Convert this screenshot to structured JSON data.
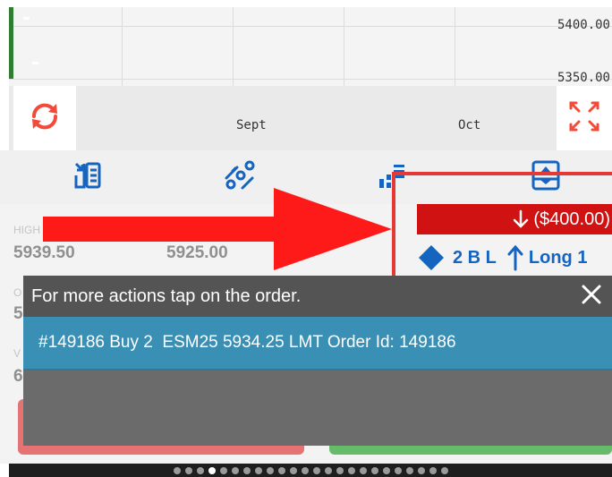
{
  "chart": {
    "price_labels": [
      "5400.00",
      "5350.00"
    ],
    "month_labels": [
      "Sept",
      "Oct"
    ],
    "candle_color": "#2e7d32"
  },
  "icons": {
    "refresh": "refresh-icon",
    "fullscreen": "fullscreen-icon",
    "toolbar": [
      "order-list-icon",
      "drawing-tools-icon",
      "indicators-icon",
      "layout-icon"
    ]
  },
  "stats": {
    "high_label": "HIGH",
    "high_value": "5939.50",
    "low_value": "5925.00",
    "open_label_partial": "O",
    "open_value_partial": "5",
    "vol_label_partial": "V",
    "vol_value_partial": "6"
  },
  "position": {
    "pl_text": "($400.00)",
    "pl_color": "#d11212",
    "working_orders": "2 B L",
    "position_text": "Long 1",
    "accent_color": "#1565c0"
  },
  "toast": {
    "header": "For more actions tap on the order.",
    "order_line": "#149186 Buy 2  ESM25 5934.25 LMT Order Id: 149186"
  },
  "pager": {
    "total_pages": 24,
    "active_index": 3
  },
  "annotation_colors": {
    "arrow": "#ff1a1a",
    "highlight_box": "#e53935"
  }
}
